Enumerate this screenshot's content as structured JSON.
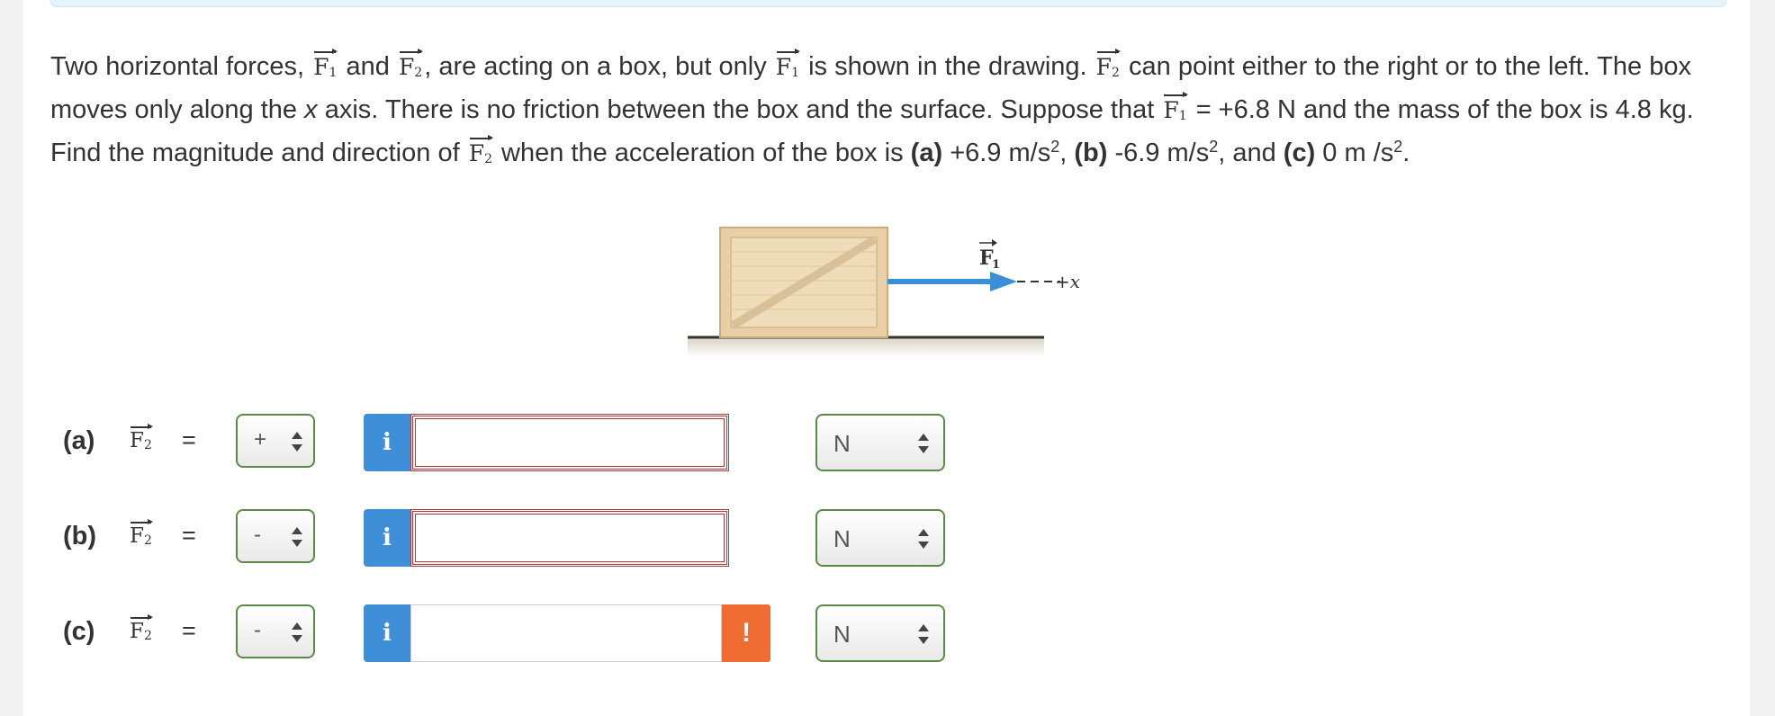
{
  "problem": {
    "t1": "Two horizontal forces,",
    "t2": "and",
    "t3": ", are acting on a box, but only",
    "t4": "is shown in the drawing.",
    "t5": "can point either to the right or to the left. The box moves only along the",
    "t5_axis": "x",
    "t6": "axis. There is no friction between the box and the surface. Suppose that",
    "t7": "= +6.8 N and the mass of the box is 4.8  kg. Find the magnitude and direction of",
    "t8": "when the acceleration of the box is",
    "a_label": "(a)",
    "a_val": "+6.9 m/s",
    "b_label": "(b)",
    "b_val": "-6.9 m/s",
    "c_label": "(c)",
    "c_val": "0 m /s",
    "and": ", and",
    "comma": ",",
    "exp": "2",
    "period": "."
  },
  "vector": {
    "F": "F",
    "sub1": "1",
    "sub2": "2"
  },
  "figure": {
    "force_label": "F",
    "force_sub": "1",
    "axis_label": "+x"
  },
  "rows": [
    {
      "label": "(a)",
      "eq": "=",
      "sign": "+",
      "value": "",
      "unit": "N",
      "status": "error"
    },
    {
      "label": "(b)",
      "eq": "=",
      "sign": "-",
      "value": "",
      "unit": "N",
      "status": "error"
    },
    {
      "label": "(c)",
      "eq": "=",
      "sign": "-",
      "value": "",
      "unit": "N",
      "status": "warning"
    }
  ],
  "buttons": {
    "info": "i",
    "warning": "!"
  },
  "colors": {
    "info": "#3f8fd8",
    "warning": "#ef6c33",
    "error_border": "#b03a3a",
    "select_border": "#5a8a4a",
    "arrow": "#3a8fd6"
  }
}
